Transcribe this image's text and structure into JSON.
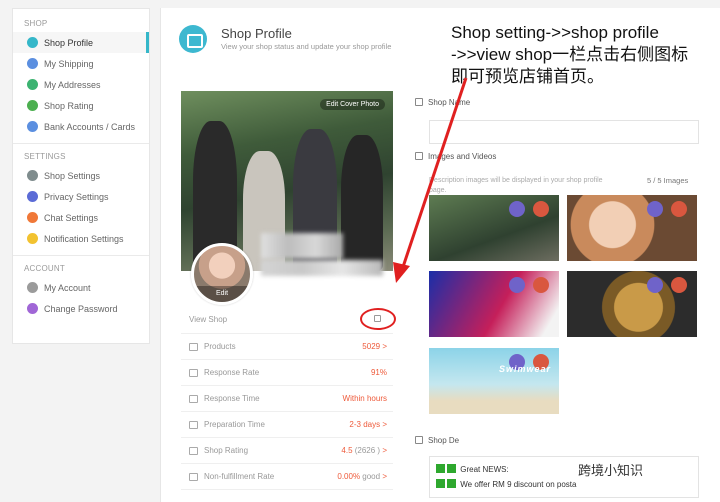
{
  "sidebar": {
    "sections": [
      {
        "title": "SHOP",
        "items": [
          {
            "label": "Shop Profile",
            "active": true,
            "icon": "shop-icon",
            "color": "#35b7c9"
          },
          {
            "label": "My Shipping",
            "icon": "shipping-icon",
            "color": "#5b8fe0"
          },
          {
            "label": "My Addresses",
            "icon": "address-icon",
            "color": "#3cb371"
          },
          {
            "label": "Shop Rating",
            "icon": "rating-icon",
            "color": "#4caf50"
          },
          {
            "label": "Bank Accounts / Cards",
            "icon": "bank-icon",
            "color": "#5b8fe0"
          }
        ]
      },
      {
        "title": "SETTINGS",
        "items": [
          {
            "label": "Shop Settings",
            "icon": "settings-icon",
            "color": "#7f8c8d"
          },
          {
            "label": "Privacy Settings",
            "icon": "privacy-icon",
            "color": "#5b6bd6"
          },
          {
            "label": "Chat Settings",
            "icon": "chat-icon",
            "color": "#f07838"
          },
          {
            "label": "Notification Settings",
            "icon": "notification-icon",
            "color": "#f2c230"
          }
        ]
      },
      {
        "title": "ACCOUNT",
        "items": [
          {
            "label": "My Account",
            "icon": "account-icon",
            "color": "#9b9b9b"
          },
          {
            "label": "Change Password",
            "icon": "password-icon",
            "color": "#a066d6"
          }
        ]
      }
    ]
  },
  "header": {
    "title": "Shop Profile",
    "subtitle": "View your shop status and update your shop profile"
  },
  "annotation": {
    "line1": "Shop setting->>shop profile",
    "line2": "->>view shop一栏点击右侧图标",
    "line3": "即可预览店铺首页。"
  },
  "profile": {
    "edit_cover_label": "Edit Cover Photo",
    "avatar_edit_label": "Edit",
    "view_shop_label": "View Shop",
    "stats": [
      {
        "label": "Products",
        "value": "5029",
        "suffix": " >",
        "icon": "products-icon"
      },
      {
        "label": "Response Rate",
        "value": "91%",
        "suffix": "",
        "icon": "response-rate-icon"
      },
      {
        "label": "Response Time",
        "value": "Within hours",
        "suffix": "",
        "icon": "response-time-icon"
      },
      {
        "label": "Preparation Time",
        "value": "2-3 days",
        "suffix": " >",
        "icon": "preparation-icon"
      },
      {
        "label": "Shop Rating",
        "value": "4.5",
        "extra": " (2626 )",
        "suffix": " >",
        "icon": "star-icon"
      },
      {
        "label": "Non-fulfillment Rate",
        "value": "0.00%",
        "extra": " good",
        "suffix": " >",
        "icon": "nonfulfillment-icon"
      }
    ]
  },
  "form": {
    "shop_name_label": "Shop Name",
    "images_label": "Images and Videos",
    "images_desc": "Description images will be displayed in your shop profile page.",
    "images_count": "5 / 5 Images",
    "thumb_caption": "Swimwear",
    "shop_desc_label": "Shop De",
    "desc_line1": "Great NEWS:",
    "desc_line2": "We offer RM 9 discount on posta"
  },
  "watermark": "跨境小知识",
  "colors": {
    "accent": "#35b7c9",
    "highlight": "#ee5a3a",
    "annotation": "#e02020"
  }
}
